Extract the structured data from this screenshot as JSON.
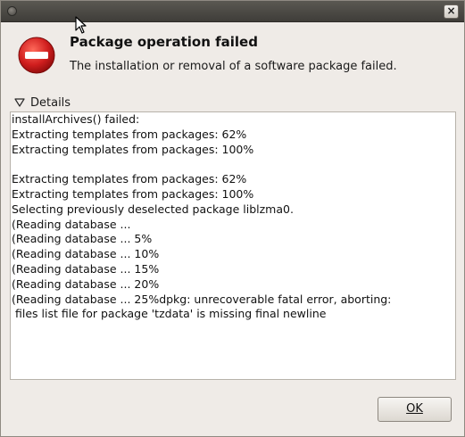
{
  "window": {
    "close_glyph": "×"
  },
  "dialog": {
    "icon": "error-stop-icon",
    "heading": "Package operation failed",
    "message": "The installation or removal of a software package failed."
  },
  "details": {
    "label": "Details",
    "expanded": true,
    "text": "installArchives() failed:\nExtracting templates from packages: 62%\nExtracting templates from packages: 100%\n\nExtracting templates from packages: 62%\nExtracting templates from packages: 100%\nSelecting previously deselected package liblzma0.\n(Reading database ...\n(Reading database ... 5%\n(Reading database ... 10%\n(Reading database ... 15%\n(Reading database ... 20%\n(Reading database ... 25%dpkg: unrecoverable fatal error, aborting:\n files list file for package 'tzdata' is missing final newline"
  },
  "buttons": {
    "ok_label": "OK"
  },
  "colors": {
    "window_bg": "#efebe7",
    "error_red": "#d01e1e",
    "titlebar": "#4b4944"
  }
}
